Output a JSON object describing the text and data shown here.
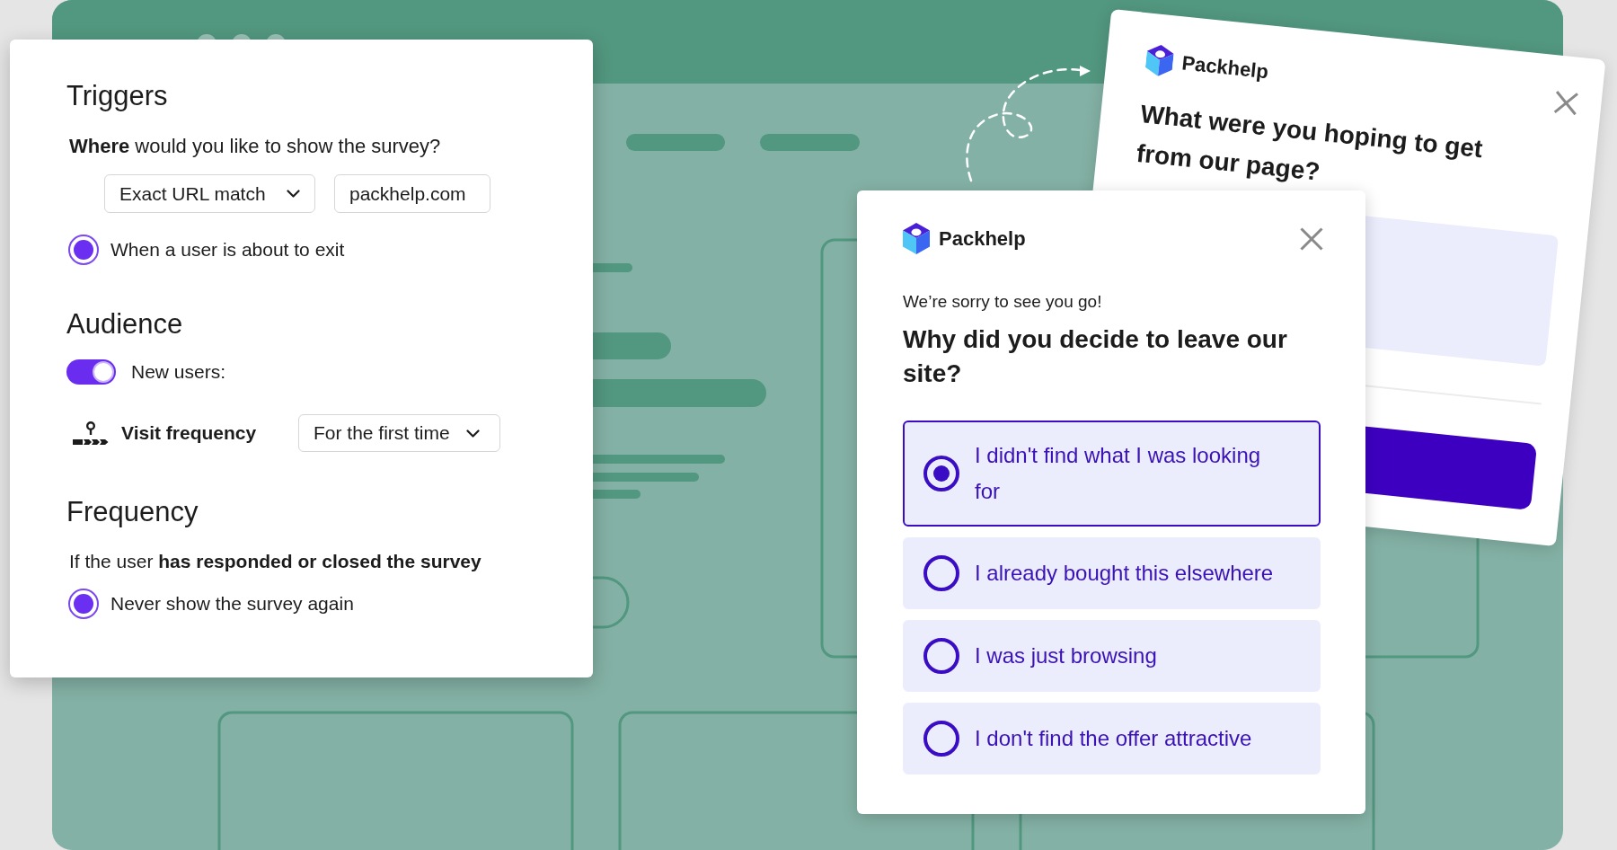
{
  "settings_panel": {
    "triggers": {
      "title": "Triggers",
      "question": "**Where** would you like to show the survey?",
      "match_type": {
        "value": "Exact URL match"
      },
      "url": {
        "value": "packhelp.com"
      },
      "option": {
        "label": "When a user is about to exit",
        "selected": true
      }
    },
    "audience": {
      "title": "Audience",
      "new_users": {
        "label": "New users:",
        "on": true
      },
      "visit_frequency": {
        "label": "Visit frequency",
        "value": "For the first time"
      }
    },
    "frequency": {
      "title": "Frequency",
      "condition": "If the user **has responded or closed the survey**",
      "option": {
        "label": "Never show the survey again",
        "selected": true
      }
    }
  },
  "feedback_survey": {
    "brand": "Packhelp",
    "question": "What were you hoping to get from our page?"
  },
  "exit_survey": {
    "brand": "Packhelp",
    "intro": "We’re sorry to see you go!",
    "question": "Why did you decide to leave our site?",
    "options": [
      {
        "label": "I didn't find what I was looking for",
        "selected": true
      },
      {
        "label": "I already bought this elsewhere",
        "selected": false
      },
      {
        "label": "I was just browsing",
        "selected": false
      },
      {
        "label": "I don't find the offer attractive",
        "selected": false
      }
    ]
  }
}
